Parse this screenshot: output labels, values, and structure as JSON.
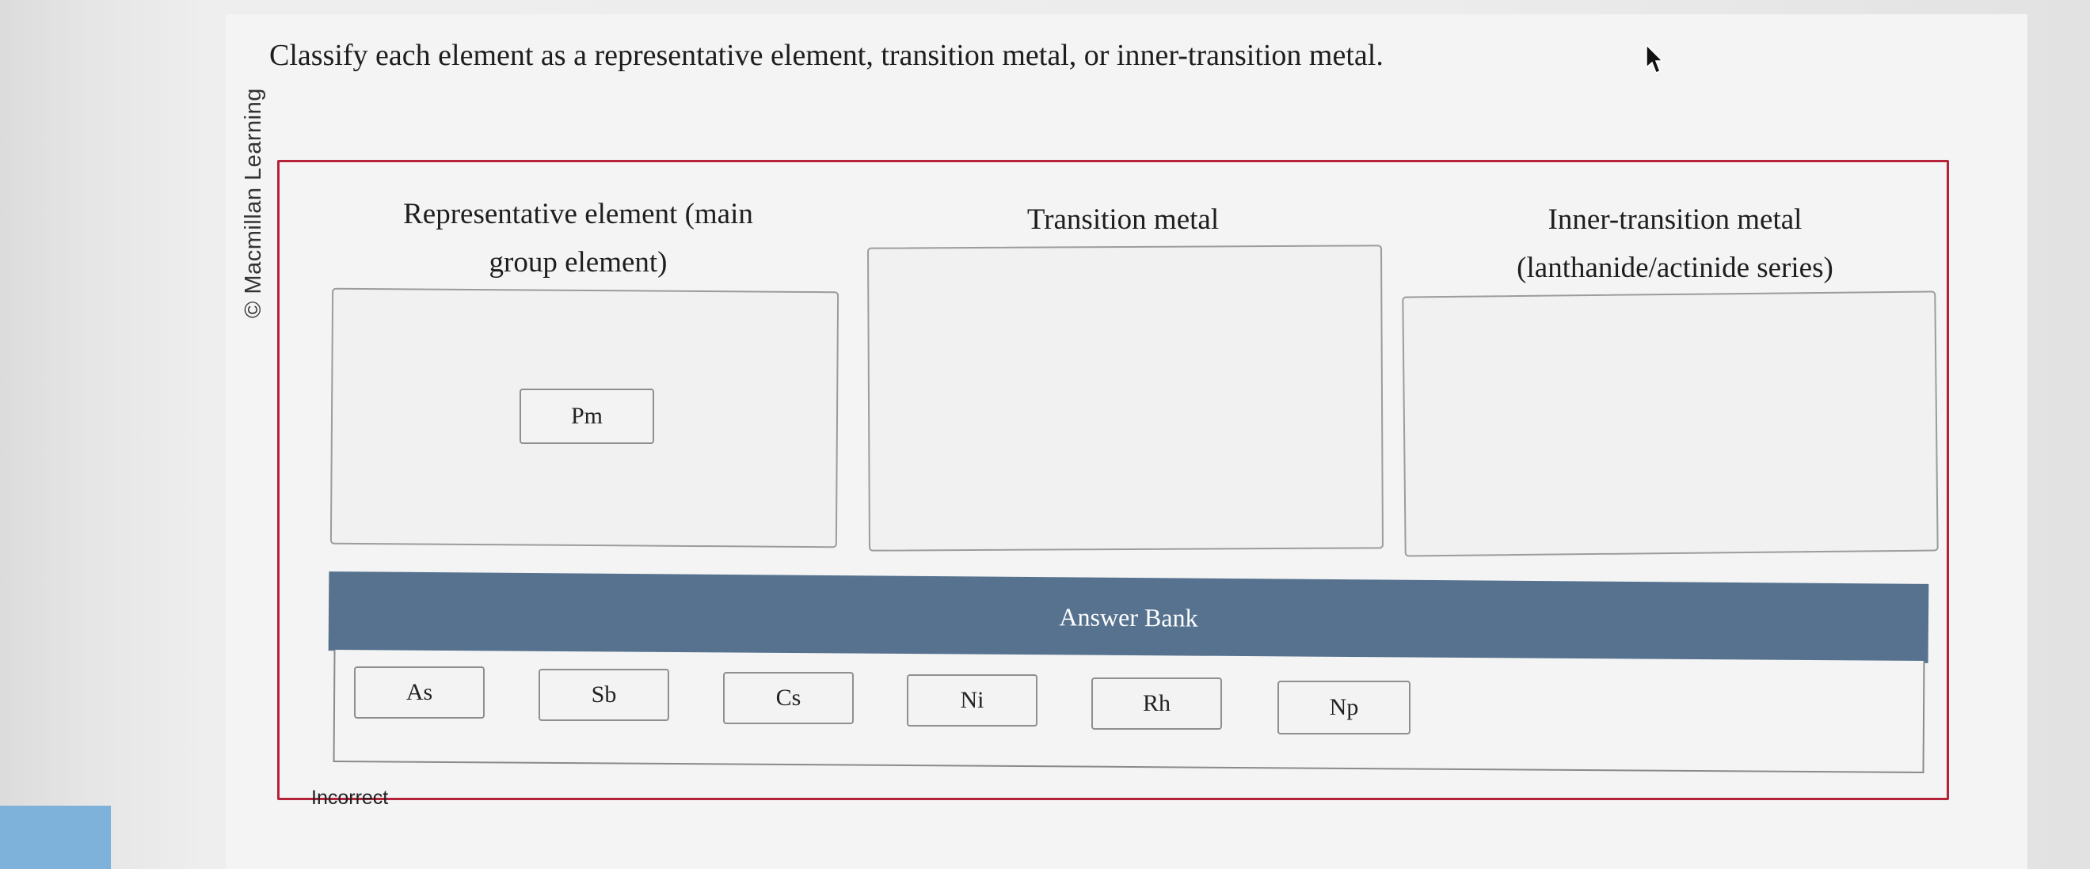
{
  "copyright": "© Macmillan Learning",
  "question": "Classify each element as a representative element, transition metal, or inner-transition metal.",
  "categories": [
    {
      "title_line1": "Representative element (main",
      "title_line2": "group element)",
      "placed": [
        "Pm"
      ]
    },
    {
      "title_line1": "Transition metal",
      "placed": []
    },
    {
      "title_line1": "Inner-transition metal",
      "title_line2": "(lanthanide/actinide series)",
      "placed": []
    }
  ],
  "answer_bank": {
    "title": "Answer Bank",
    "items": [
      "As",
      "Sb",
      "Cs",
      "Ni",
      "Rh",
      "Np"
    ]
  },
  "status": "Incorrect",
  "colors": {
    "frame_border": "#b5223a",
    "bank_header": "#56728f",
    "left_accent": "#7fb2da"
  },
  "icons": {
    "cursor": "mouse-pointer-icon"
  }
}
